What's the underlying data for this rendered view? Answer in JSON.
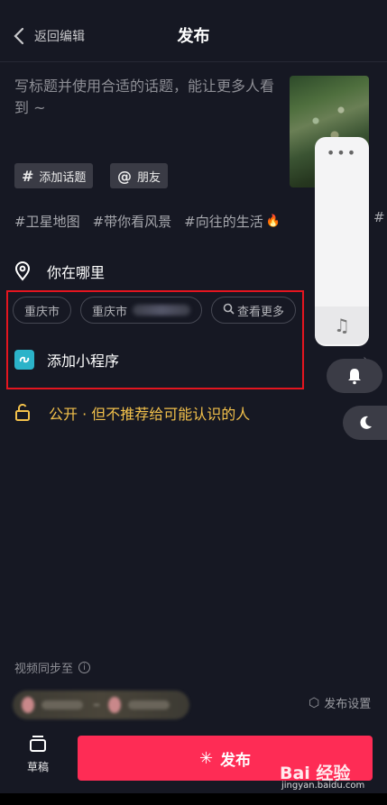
{
  "header": {
    "back_label": "返回编辑",
    "title": "发布"
  },
  "caption": {
    "placeholder": "写标题并使用合适的话题，能让更多人看到 ~"
  },
  "tag_buttons": [
    {
      "icon": "hashtag-icon",
      "label": "添加话题"
    },
    {
      "icon": "at-icon",
      "label": "朋友"
    }
  ],
  "hashtags": [
    "#卫星地图",
    "#带你看风景",
    "#向往的生活"
  ],
  "hashtag_more": "#",
  "location": {
    "label": "你在哪里",
    "chips": [
      "重庆市",
      "重庆市",
      "查看更多"
    ]
  },
  "mini_program": {
    "label": "添加小程序"
  },
  "privacy": {
    "label": "公开 · 但不推荐给可能认识的人"
  },
  "float_panel": {
    "dots": "•••"
  },
  "sync": {
    "label": "视频同步至",
    "info": "i"
  },
  "settings": {
    "label": "发布设置"
  },
  "draft": {
    "label": "草稿"
  },
  "publish": {
    "label": "发布"
  },
  "watermark": {
    "brand": "Bai 经验",
    "url": "jingyan.baidu.com"
  },
  "colors": {
    "accent": "#fe2c55",
    "privacy": "#f3c14b",
    "highlight_box": "#e4151f",
    "background": "#161823"
  }
}
